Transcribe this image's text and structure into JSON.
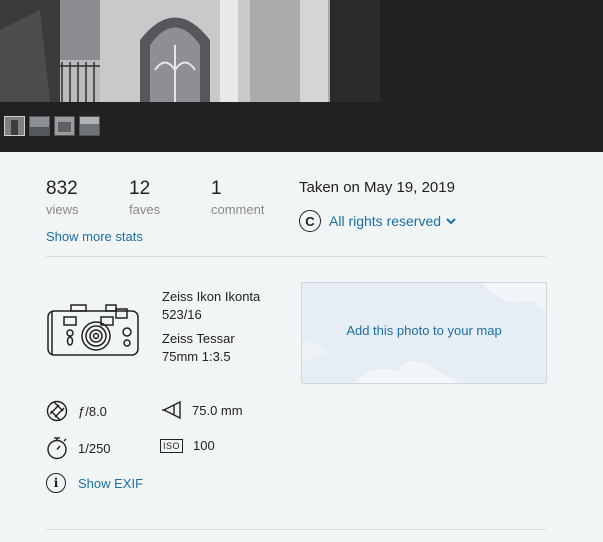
{
  "viewer": {
    "thumbnails": [
      {
        "name": "thumb-1",
        "active": true
      },
      {
        "name": "thumb-2",
        "active": false
      },
      {
        "name": "thumb-3",
        "active": false
      },
      {
        "name": "thumb-4",
        "active": false
      }
    ]
  },
  "stats": {
    "views": {
      "count": "832",
      "label": "views"
    },
    "faves": {
      "count": "12",
      "label": "faves"
    },
    "comments": {
      "count": "1",
      "label": "comment"
    },
    "show_more_label": "Show more stats"
  },
  "taken": "Taken on May 19, 2019",
  "license": {
    "symbol": "C",
    "label": "All rights reserved",
    "icon": "chevron-down-icon"
  },
  "camera": {
    "icon": "camera-icon",
    "name_line1": "Zeiss Ikon Ikonta",
    "name_line2": "523/16",
    "lens_line1": "Zeiss Tessar",
    "lens_line2": "75mm 1:3.5"
  },
  "map": {
    "label": "Add this photo to your map"
  },
  "exif": {
    "aperture": "ƒ/8.0",
    "focal_length": "75.0 mm",
    "shutter": "1/250",
    "iso_badge": "ISO",
    "iso": "100",
    "info_symbol": "i",
    "show_exif_label": "Show EXIF"
  },
  "colors": {
    "link": "#1a6fa3",
    "viewer_bg": "#212124",
    "page_bg": "#f2f5f6"
  }
}
